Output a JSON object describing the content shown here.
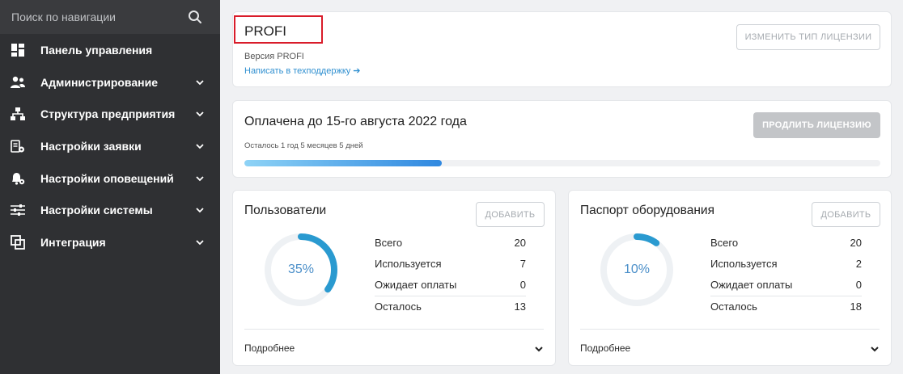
{
  "sidebar": {
    "search": {
      "placeholder": "Поиск по навигации"
    },
    "items": [
      {
        "label": "Панель управления",
        "icon": "dashboard-icon",
        "has_chevron": false
      },
      {
        "label": "Администрирование",
        "icon": "users-icon",
        "has_chevron": true
      },
      {
        "label": "Структура предприятия",
        "icon": "hierarchy-icon",
        "has_chevron": true
      },
      {
        "label": "Настройки заявки",
        "icon": "request-settings-icon",
        "has_chevron": true
      },
      {
        "label": "Настройки оповещений",
        "icon": "notification-settings-icon",
        "has_chevron": true
      },
      {
        "label": "Настройки системы",
        "icon": "sliders-icon",
        "has_chevron": true
      },
      {
        "label": "Интеграция",
        "icon": "integration-icon",
        "has_chevron": true
      }
    ]
  },
  "license": {
    "title": "PROFI",
    "version": "Версия PROFI",
    "support_link": "Написать в техподдержку ➔",
    "change_button": "ИЗМЕНИТЬ ТИП ЛИЦЕНЗИИ",
    "highlight_color": "#d91c2a"
  },
  "payment": {
    "title": "Оплачена до 15-го августа 2022 года",
    "remaining": "Осталось 1 год 5 месяцев 5 дней",
    "extend_button": "ПРОДЛИТЬ ЛИЦЕНЗИЮ",
    "progress_fraction": 0.31
  },
  "users": {
    "title": "Пользователи",
    "add_button": "ДОБАВИТЬ",
    "percent_label": "35%",
    "percent": 35,
    "stats": [
      {
        "label": "Всего",
        "value": "20"
      },
      {
        "label": "Используется",
        "value": "7"
      },
      {
        "label": "Ожидает оплаты",
        "value": "0"
      },
      {
        "label": "Осталось",
        "value": "13"
      }
    ],
    "more": "Подробнее"
  },
  "equipment": {
    "title": "Паспорт оборудования",
    "add_button": "ДОБАВИТЬ",
    "percent_label": "10%",
    "percent": 10,
    "stats": [
      {
        "label": "Всего",
        "value": "20"
      },
      {
        "label": "Используется",
        "value": "2"
      },
      {
        "label": "Ожидает оплаты",
        "value": "0"
      },
      {
        "label": "Осталось",
        "value": "18"
      }
    ],
    "more": "Подробнее"
  },
  "colors": {
    "sidebar_bg": "#2f3033",
    "accent_blue": "#2a9ad0",
    "donut_track": "#eef1f4"
  }
}
